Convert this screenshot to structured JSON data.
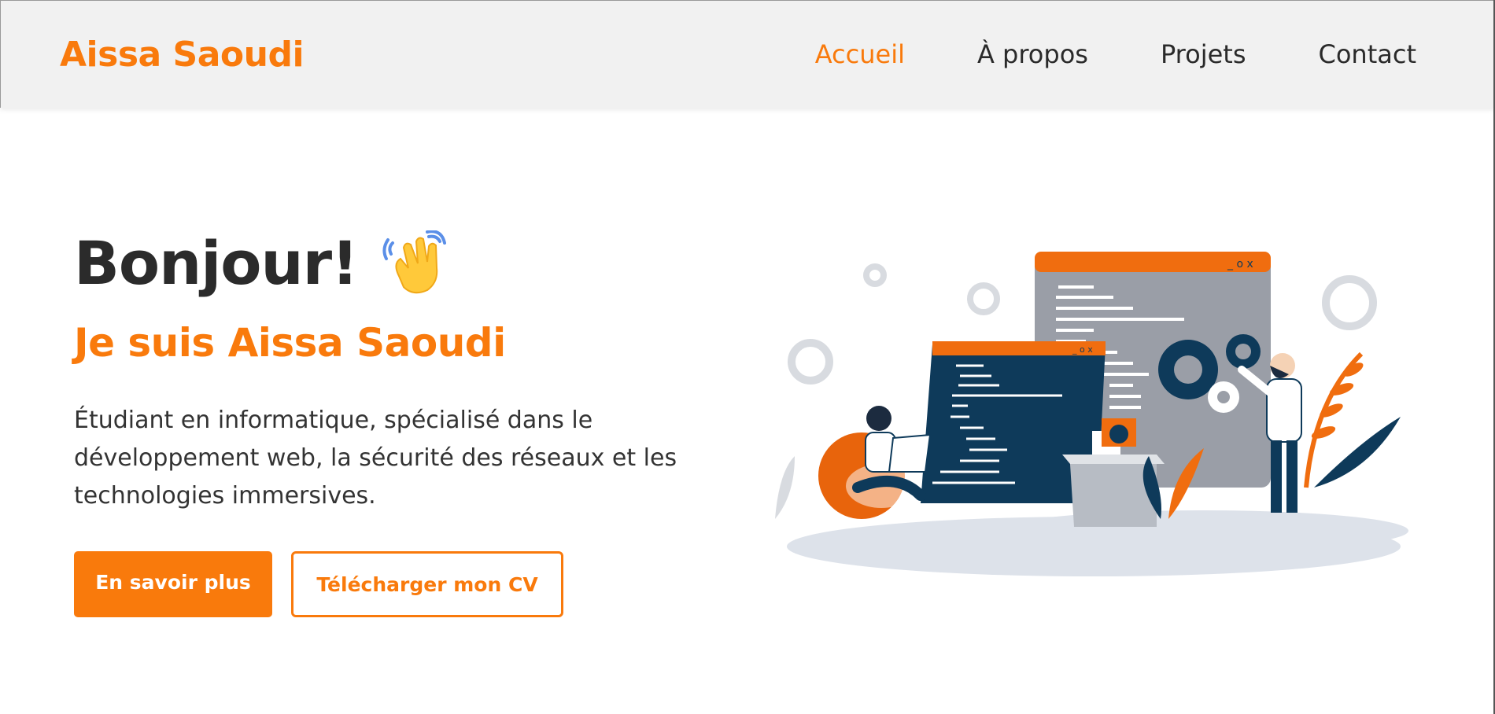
{
  "brand": {
    "name": "Aissa Saoudi"
  },
  "nav": {
    "items": [
      {
        "label": "Accueil",
        "active": true
      },
      {
        "label": "À propos",
        "active": false
      },
      {
        "label": "Projets",
        "active": false
      },
      {
        "label": "Contact",
        "active": false
      }
    ]
  },
  "hero": {
    "greeting": "Bonjour!",
    "wave_icon": "waving-hand-icon",
    "subtitle": "Je suis Aissa Saoudi",
    "description": "Étudiant en informatique, spécialisé dans le développement web, la sécurité des réseaux et les technologies immersives.",
    "primary_button": "En savoir plus",
    "secondary_button": "Télécharger mon CV"
  },
  "colors": {
    "accent": "#f97a0c",
    "navbar_bg": "#f1f1f1",
    "navy": "#0e3a5a",
    "window_gray": "#9a9ea7"
  }
}
